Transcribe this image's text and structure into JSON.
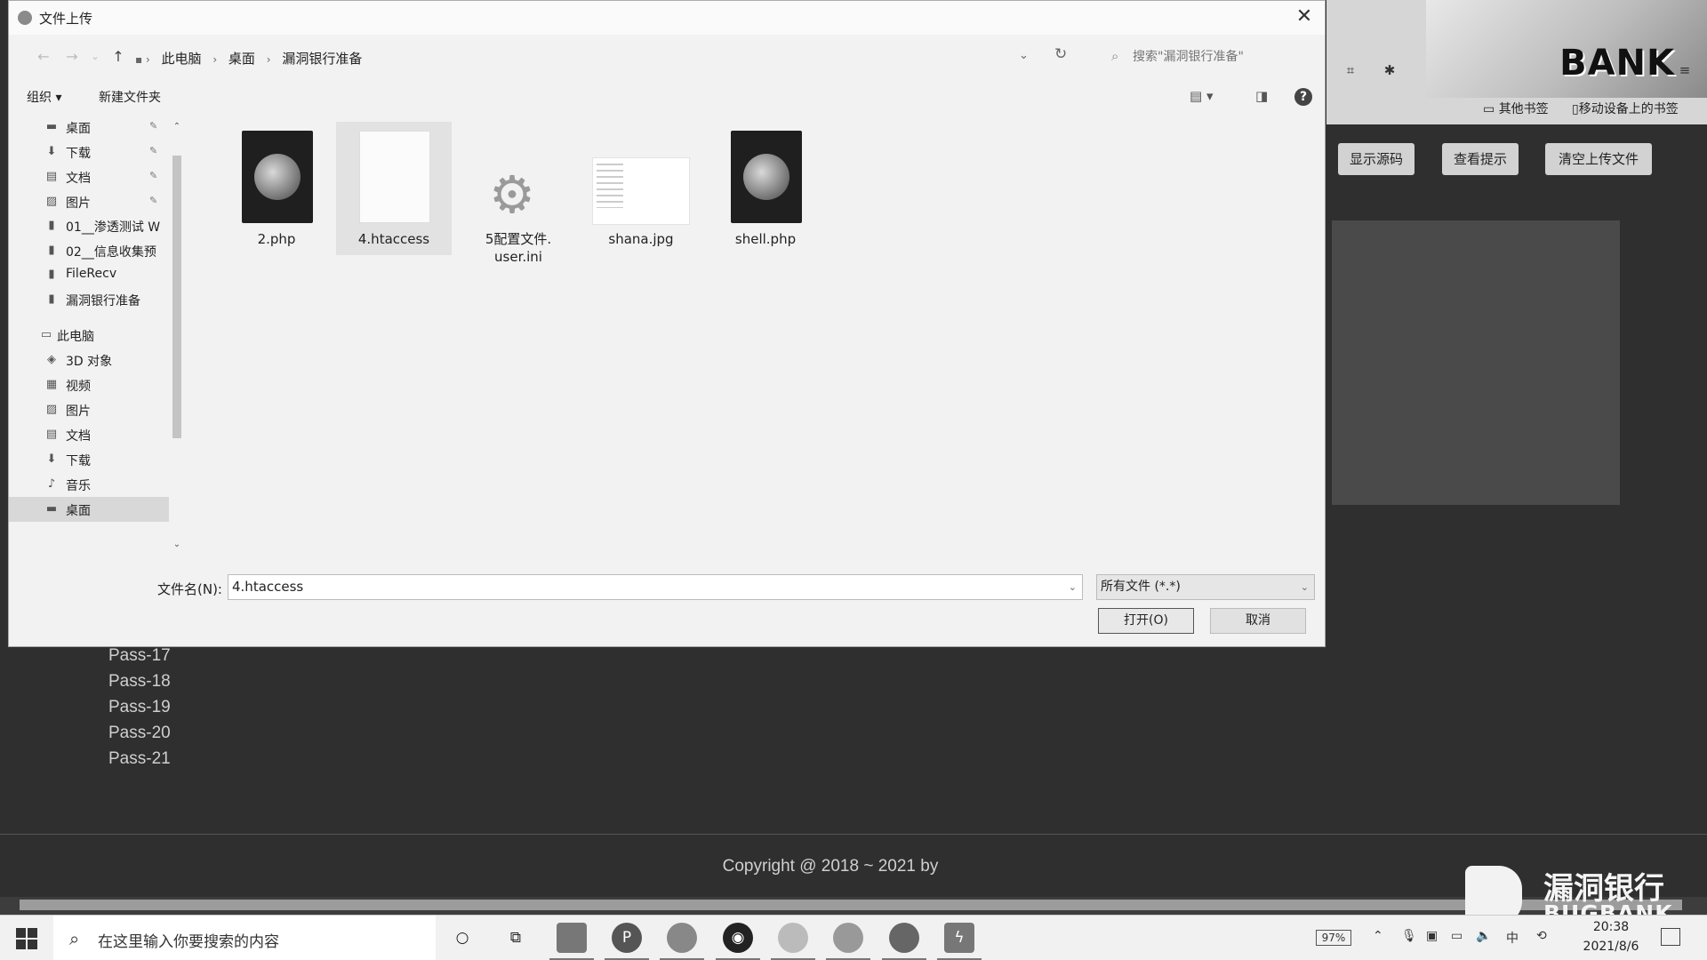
{
  "background": {
    "banner_text": "BANK",
    "bookmarks": [
      "其他书签",
      "移动设备上的书签"
    ],
    "buttons": [
      "显示源码",
      "查看提示",
      "清空上传文件"
    ],
    "pass_list": [
      "Pass-17",
      "Pass-18",
      "Pass-19",
      "Pass-20",
      "Pass-21"
    ],
    "copyright": "Copyright @ 2018 ~ 2021 by",
    "watermark": {
      "title": "漏洞银行",
      "subtitle": "BUGBANK"
    }
  },
  "dialog": {
    "title": "文件上传",
    "breadcrumb": [
      "此电脑",
      "桌面",
      "漏洞银行准备"
    ],
    "search_placeholder": "搜索\"漏洞银行准备\"",
    "toolbar": {
      "organize": "组织 ▾",
      "new_folder": "新建文件夹"
    },
    "nav_items": [
      {
        "label": "桌面",
        "icon": "desktop-icon",
        "pinned": true
      },
      {
        "label": "下载",
        "icon": "download-icon",
        "pinned": true
      },
      {
        "label": "文档",
        "icon": "document-icon",
        "pinned": true
      },
      {
        "label": "图片",
        "icon": "picture-icon",
        "pinned": true
      },
      {
        "label": "01__渗透测试 W",
        "icon": "folder-icon",
        "pinned": false
      },
      {
        "label": "02__信息收集预",
        "icon": "folder-icon",
        "pinned": false
      },
      {
        "label": "FileRecv",
        "icon": "folder-icon",
        "pinned": false
      },
      {
        "label": "漏洞银行准备",
        "icon": "folder-icon",
        "pinned": false
      },
      {
        "label": "此电脑",
        "icon": "computer-icon",
        "pinned": false
      },
      {
        "label": "3D 对象",
        "icon": "cube-icon",
        "pinned": false
      },
      {
        "label": "视频",
        "icon": "video-icon",
        "pinned": false
      },
      {
        "label": "图片",
        "icon": "picture-icon",
        "pinned": false
      },
      {
        "label": "文档",
        "icon": "document-icon",
        "pinned": false
      },
      {
        "label": "下载",
        "icon": "download-icon",
        "pinned": false
      },
      {
        "label": "音乐",
        "icon": "music-icon",
        "pinned": false
      },
      {
        "label": "桌面",
        "icon": "desktop-icon",
        "pinned": false,
        "selected": true
      }
    ],
    "files": [
      {
        "name": "2.php",
        "type": "php"
      },
      {
        "name": "4.htaccess",
        "type": "doc",
        "selected": true
      },
      {
        "name": "5配置文件.user.ini",
        "line1": "5配置文件.",
        "line2": "user.ini",
        "type": "cfg"
      },
      {
        "name": "shana.jpg",
        "type": "img"
      },
      {
        "name": "shell.php",
        "type": "php"
      }
    ],
    "filename_label": "文件名(N):",
    "filename_value": "4.htaccess",
    "filter_value": "所有文件 (*.*)",
    "open_label": "打开(O)",
    "cancel_label": "取消"
  },
  "taskbar": {
    "search_text": "在这里输入你要搜索的内容",
    "battery": "97%",
    "time": "20:38",
    "date": "2021/8/6"
  }
}
